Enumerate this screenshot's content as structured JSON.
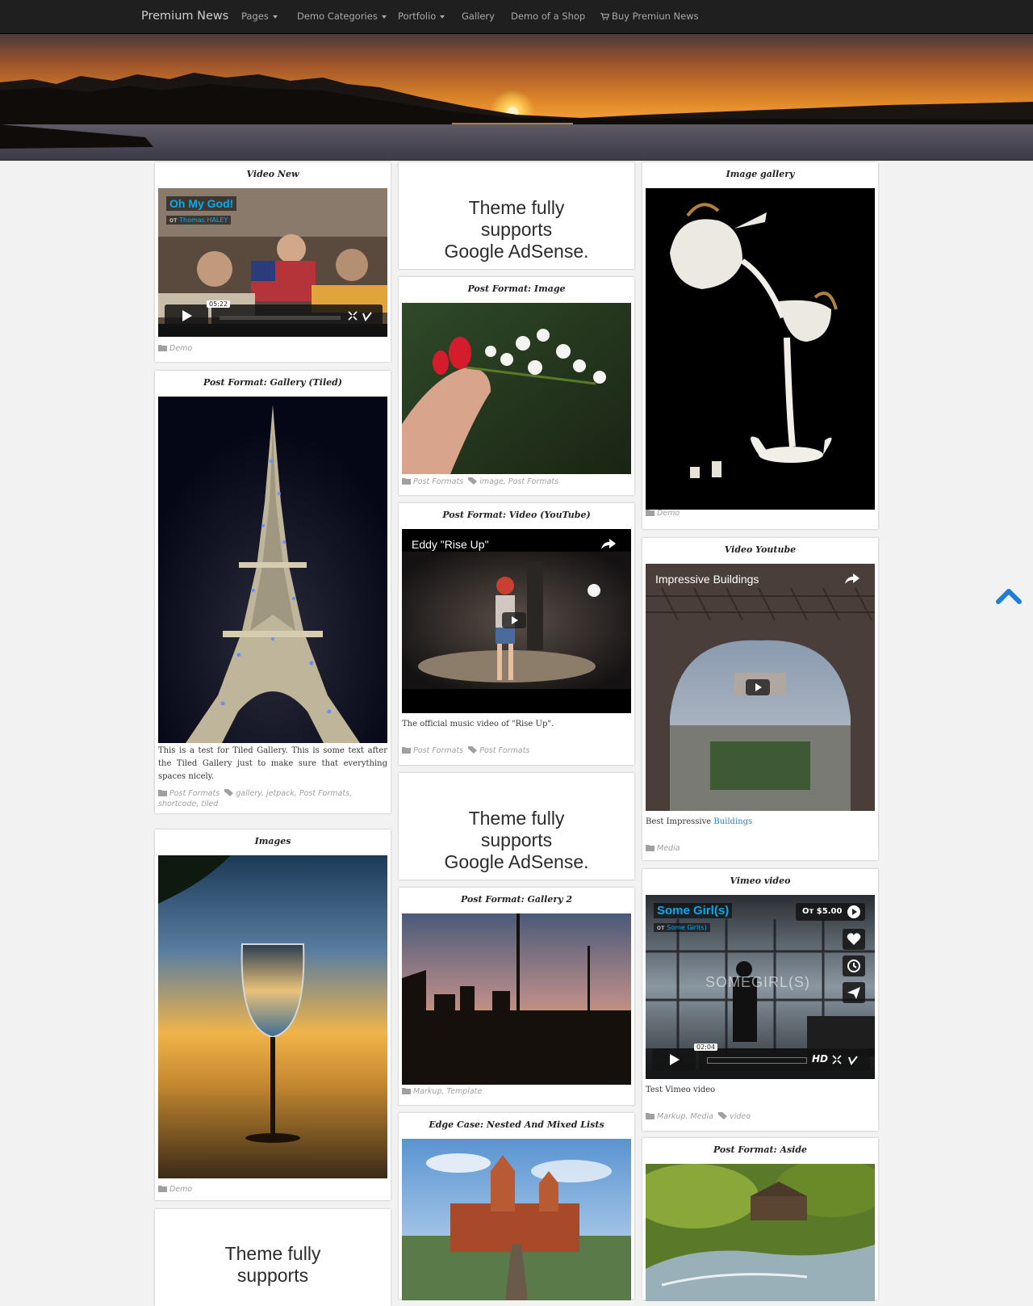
{
  "navbar": {
    "brand": "Premium News",
    "items": [
      {
        "label": "Pages",
        "dropdown": true
      },
      {
        "label": "Demo Categories",
        "dropdown": true
      },
      {
        "label": "Portfolio",
        "dropdown": true
      },
      {
        "label": "Gallery",
        "dropdown": false
      },
      {
        "label": "Demo of a Shop",
        "dropdown": false
      },
      {
        "label": "Buy Premiun News",
        "dropdown": false
      }
    ]
  },
  "adsense_lines": [
    "Theme fully",
    "supports",
    "Google AdSense."
  ],
  "col1": {
    "video_news": {
      "title": "Video New",
      "vimeo_title": "Oh My God!",
      "vimeo_from": "от",
      "vimeo_author": "Thomas HALEY",
      "duration": "05:22",
      "category": "Demo"
    },
    "gallery_tiled": {
      "title": "Post Format: Gallery (Tiled)",
      "description": "This is a test for Tiled Gallery. This is some text after the Tiled Gallery just to make sure that everything spaces nicely.",
      "category": "Post Formats",
      "tags": "gallery, jetpack, Post Formats,",
      "tags_line2": "shortcode, tiled"
    },
    "images": {
      "title": "Images",
      "category": "Demo"
    }
  },
  "col2": {
    "post_image": {
      "title": "Post Format: Image",
      "category": "Post Formats",
      "tags": "image, Post Formats"
    },
    "post_video": {
      "title": "Post Format: Video (YouTube)",
      "video_title": "Eddy \"Rise Up\"",
      "description": "The official music video of \"Rise Up\".",
      "category": "Post Formats",
      "tags": "Post Formats"
    },
    "gallery2": {
      "title": "Post Format: Gallery 2",
      "category": "Markup, Template"
    },
    "edge_case": {
      "title": "Edge Case: Nested And Mixed Lists"
    }
  },
  "col3": {
    "image_gallery": {
      "title": "Image gallery",
      "category": "Demo"
    },
    "video_youtube": {
      "title": "Video Youtube",
      "video_title": "Impressive Buildings",
      "description": "Best Impressive",
      "description_link": "Buildings",
      "category": "Media"
    },
    "vimeo_video": {
      "title": "Vimeo video",
      "vimeo_title": "Some Girl(s)",
      "vimeo_from": "от",
      "vimeo_author": "Some Girl(s)",
      "price": "От $5.00",
      "overlay_text": "SOMEGIRL(S)",
      "duration": "02:04",
      "hd": "HD",
      "description": "Test Vimeo video",
      "category": "Markup, Media",
      "tags": "video"
    },
    "aside": {
      "title": "Post Format: Aside"
    }
  },
  "colors": {
    "navbar_bg": "#1f1f1f",
    "page_bg": "#f2f2f2",
    "link": "#2a7fc1",
    "vimeo_title": "#00adef",
    "scroll_top": "#1e7ed6"
  }
}
